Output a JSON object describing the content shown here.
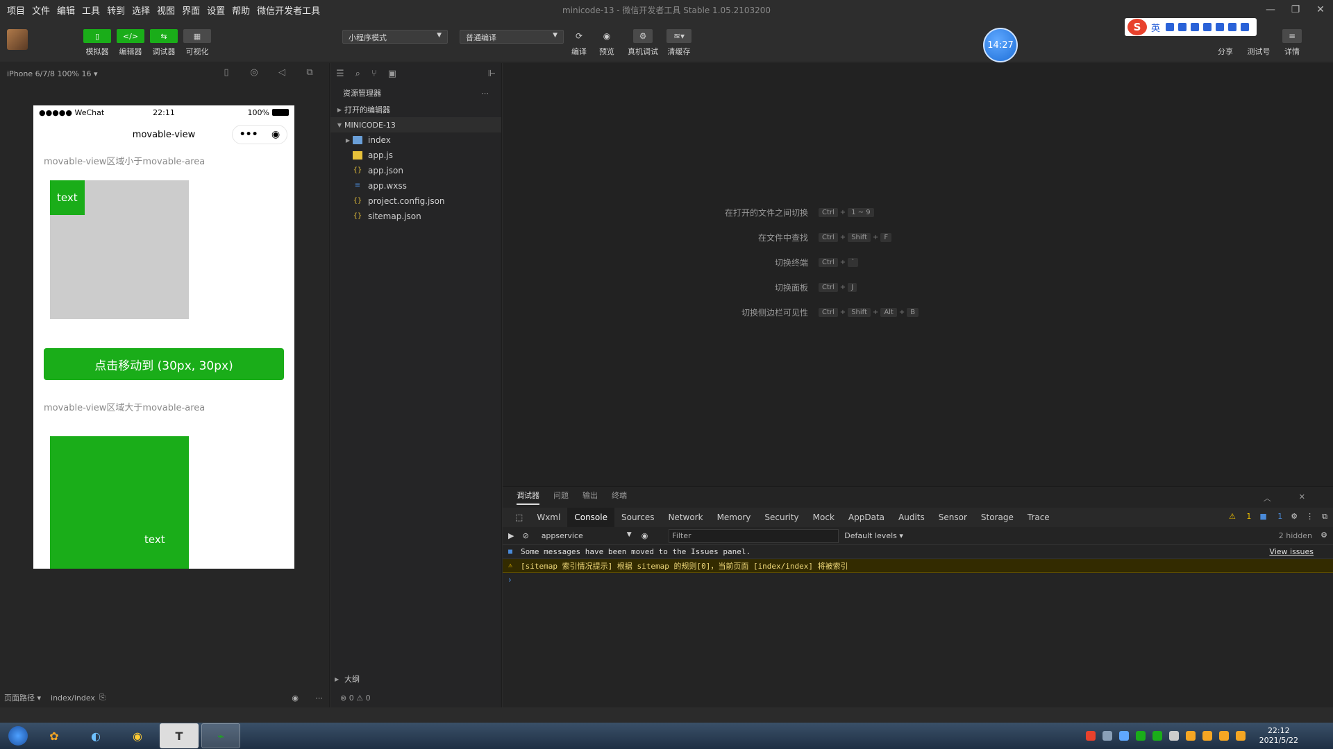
{
  "menu": [
    "项目",
    "文件",
    "编辑",
    "工具",
    "转到",
    "选择",
    "视图",
    "界面",
    "设置",
    "帮助",
    "微信开发者工具"
  ],
  "window_title": "minicode-13 - 微信开发者工具 Stable 1.05.2103200",
  "toolbar": {
    "simulator": "模拟器",
    "editor": "编辑器",
    "debugger": "调试器",
    "visual": "可视化",
    "mode_select": "小程序模式",
    "compile_select": "普通编译",
    "compile": "编译",
    "preview": "预览",
    "remote_debug": "真机调试",
    "clear_cache": "清缓存",
    "share": "分享",
    "test_account": "测试号",
    "details": "详情",
    "clock_badge": "14:27",
    "ime_label": "英"
  },
  "simulator": {
    "device": "iPhone 6/7/8 100% 16 ▾",
    "status_carrier": "●●●●● WeChat",
    "status_time": "22:11",
    "status_battery": "100%",
    "nav_title": "movable-view",
    "section1": "movable-view区域小于movable-area",
    "mv1_text": "text",
    "move_button": "点击移动到 (30px, 30px)",
    "section2": "movable-view区域大于movable-area",
    "mv2_text": "text",
    "path_label": "页面路径 ▾",
    "path_value": "index/index"
  },
  "explorer": {
    "title": "资源管理器",
    "open_editors": "打开的编辑器",
    "project": "MINICODE-13",
    "files": [
      {
        "name": "index",
        "icon": "folder-icon",
        "color": "#6a9fd8"
      },
      {
        "name": "app.js",
        "icon": "js-file-icon",
        "color": "#e8c23a"
      },
      {
        "name": "app.json",
        "icon": "json-file-icon",
        "color": "#e8c23a"
      },
      {
        "name": "app.wxss",
        "icon": "wxss-file-icon",
        "color": "#4a8ad8"
      },
      {
        "name": "project.config.json",
        "icon": "json-file-icon",
        "color": "#e8c23a"
      },
      {
        "name": "sitemap.json",
        "icon": "json-file-icon",
        "color": "#e8c23a"
      }
    ],
    "outline": "大纲",
    "status": "⊗ 0 ⚠ 0"
  },
  "shortcuts": [
    {
      "label": "在打开的文件之间切换",
      "keys": [
        "Ctrl",
        "1 ~ 9"
      ]
    },
    {
      "label": "在文件中查找",
      "keys": [
        "Ctrl",
        "Shift",
        "F"
      ]
    },
    {
      "label": "切换终端",
      "keys": [
        "Ctrl",
        "`"
      ]
    },
    {
      "label": "切换面板",
      "keys": [
        "Ctrl",
        "J"
      ]
    },
    {
      "label": "切换侧边栏可见性",
      "keys": [
        "Ctrl",
        "Shift",
        "Alt",
        "B"
      ]
    }
  ],
  "devtools": {
    "top_tabs": [
      "调试器",
      "问题",
      "输出",
      "终端"
    ],
    "tabs": [
      "Wxml",
      "Console",
      "Sources",
      "Network",
      "Memory",
      "Security",
      "Mock",
      "AppData",
      "Audits",
      "Sensor",
      "Storage",
      "Trace"
    ],
    "active_tab": "Console",
    "warn_count": "1",
    "info_count": "1",
    "context": "appservice",
    "filter_placeholder": "Filter",
    "levels": "Default levels ▾",
    "hidden": "2 hidden",
    "messages": [
      {
        "type": "info",
        "text": "Some messages have been moved to the Issues panel.",
        "link": "View issues"
      },
      {
        "type": "warn",
        "text": "[sitemap 索引情况提示] 根据 sitemap 的规则[0]，当前页面 [index/index] 将被索引"
      }
    ]
  },
  "taskbar": {
    "time": "22:12",
    "date": "2021/5/22",
    "apps": [
      "T"
    ]
  },
  "colors": {
    "wechat_green": "#1aad19",
    "area_grey": "#cccccc"
  }
}
